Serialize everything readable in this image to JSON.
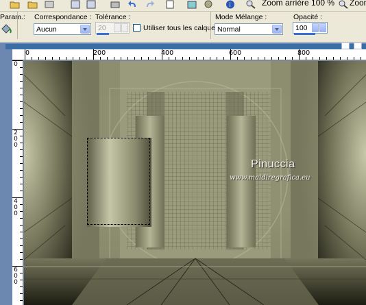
{
  "toolbar": {
    "zoom_out_label": "Zoom arrière 100 %",
    "zoom_label": "Zoom"
  },
  "options": {
    "param_label": "Param.:",
    "match_mode_label": "Correspondance :",
    "match_mode_value": "Aucun",
    "tolerance_label": "Tolérance :",
    "tolerance_value": "20",
    "use_all_layers_label": "Utiliser tous les calques",
    "use_all_layers_checked": false,
    "blend_mode_label": "Mode Mélange :",
    "blend_mode_value": "Normal",
    "opacity_label": "Opacité :",
    "opacity_value": "100"
  },
  "ruler": {
    "h_labels": [
      "0",
      "200",
      "400",
      "600",
      "800"
    ],
    "v_labels": [
      [
        "0"
      ],
      [
        "2",
        "0",
        "0"
      ],
      [
        "4",
        "0",
        "0"
      ],
      [
        "6",
        "0",
        "0"
      ]
    ]
  },
  "watermark": {
    "name": "Pinuccia",
    "url": "www.maidiregrafica.eu"
  },
  "colors": {
    "accent": "#3a6ea5",
    "image_tone": "#a8a88a"
  }
}
